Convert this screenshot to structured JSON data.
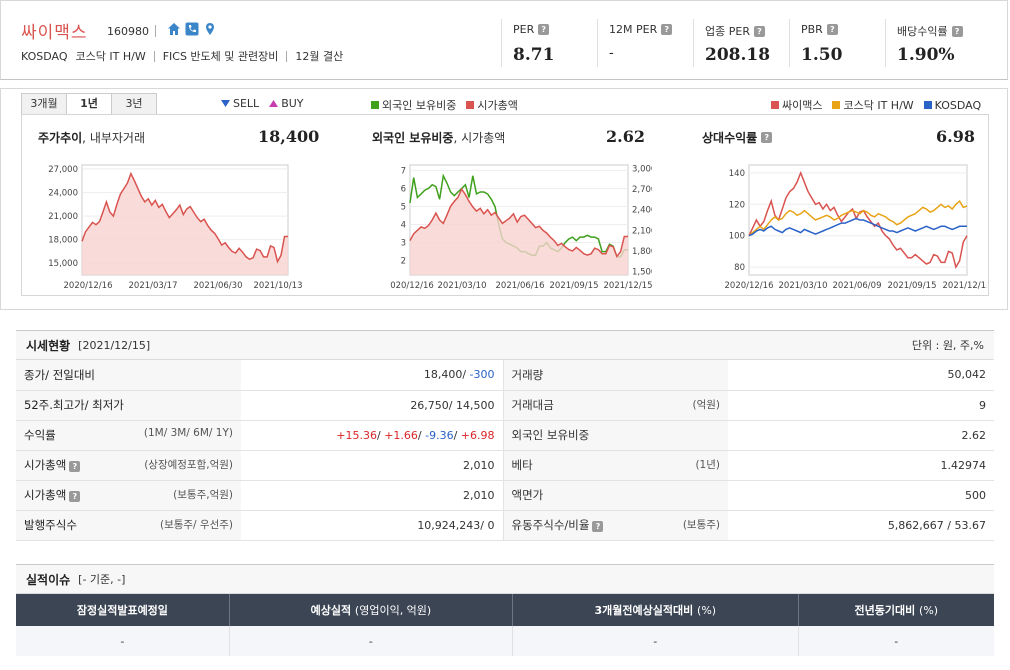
{
  "header": {
    "name": "싸이맥스",
    "code": "160980",
    "market": "KOSDAQ",
    "sector": "코스닥 IT H/W",
    "fics": "FICS 반도체 및 관련장비",
    "settle": "12월 결산",
    "metrics": [
      {
        "label": "PER",
        "value": "8.71"
      },
      {
        "label": "12M PER",
        "value": "-"
      },
      {
        "label": "업종 PER",
        "value": "208.18"
      },
      {
        "label": "PBR",
        "value": "1.50"
      },
      {
        "label": "배당수익률",
        "value": "1.90%"
      }
    ]
  },
  "chart_panel": {
    "tabs": [
      "3개월",
      "1년",
      "3년"
    ],
    "active_tab": "1년",
    "legend_trade": [
      {
        "label": "SELL",
        "color": "#2a62c8"
      },
      {
        "label": "BUY",
        "color": "#c83cb0"
      }
    ],
    "legend_foreign": [
      {
        "label": "외국인 보유비중",
        "color": "#3ea01c"
      },
      {
        "label": "시가총액",
        "color": "#d9534f"
      }
    ],
    "legend_relative": [
      {
        "label": "싸이맥스",
        "color": "#d9534f"
      },
      {
        "label": "코스닥 IT H/W",
        "color": "#e8a317"
      },
      {
        "label": "KOSDAQ",
        "color": "#2a62c8"
      }
    ]
  },
  "chart_data": [
    {
      "type": "area",
      "title": "주가추이",
      "subtitle": "내부자거래",
      "headline": "18,400",
      "x_ticks": [
        "2020/12/16",
        "2021/03/17",
        "2021/06/30",
        "2021/10/13"
      ],
      "y_ticks": [
        "27,000",
        "24,000",
        "21,000",
        "18,000",
        "15,000"
      ],
      "ylim": [
        13500,
        27500
      ],
      "series": [
        {
          "name": "주가",
          "color": "#d9534f",
          "values": [
            17800,
            19000,
            19600,
            20200,
            19900,
            20300,
            21500,
            22800,
            21500,
            21000,
            22500,
            23800,
            24500,
            25200,
            26400,
            25500,
            24500,
            23500,
            22800,
            23200,
            22400,
            23000,
            22100,
            22500,
            21600,
            20800,
            21300,
            21800,
            22400,
            21200,
            21900,
            22200,
            21500,
            20800,
            20300,
            20600,
            19800,
            19200,
            18800,
            18100,
            17300,
            17600,
            17000,
            16500,
            16300,
            16900,
            16400,
            15800,
            15500,
            15700,
            16800,
            16600,
            15800,
            15800,
            17200,
            17000,
            15200,
            16000,
            18400,
            18400
          ]
        }
      ]
    },
    {
      "type": "line",
      "title": "외국인 보유비중",
      "subtitle": "시가총액",
      "headline": "2.62",
      "x_ticks": [
        "020/12/16",
        "2021/03/10",
        "2021/06/16",
        "2021/09/15",
        "2021/12/15"
      ],
      "y_ticks_left": [
        "7",
        "6",
        "5",
        "4",
        "3",
        "2"
      ],
      "y_ticks_right": [
        "3,000",
        "2,700",
        "2,400",
        "2,100",
        "1,800",
        "1,500"
      ],
      "ylim_left": [
        1.2,
        7.3
      ],
      "ylim_right": [
        1450,
        3050
      ],
      "series": [
        {
          "name": "외국인 보유비중",
          "color": "#3ea01c",
          "axis": "left",
          "values": [
            5.2,
            6.6,
            5.5,
            5.7,
            5.9,
            6.0,
            6.2,
            6.1,
            5.4,
            6.7,
            6.3,
            5.8,
            5.6,
            5.8,
            6.0,
            6.2,
            5.5,
            6.7,
            5.7,
            5.8,
            5.8,
            5.7,
            5.4,
            5.0,
            4.0,
            3.2,
            3.0,
            2.9,
            2.8,
            2.7,
            2.5,
            2.5,
            2.4,
            2.3,
            2.3,
            2.8,
            2.8,
            3.0,
            2.7,
            2.6,
            2.5,
            2.7,
            3.0,
            3.2,
            3.3,
            3.1,
            3.3,
            3.3,
            3.4,
            3.3,
            3.3,
            3.2,
            2.5,
            2.5,
            2.9,
            2.8,
            2.2,
            2.2,
            2.6,
            2.6
          ]
        },
        {
          "name": "시가총액",
          "color": "#d9534f",
          "axis": "right",
          "values": [
            1950,
            2050,
            2100,
            2150,
            2130,
            2170,
            2250,
            2350,
            2250,
            2200,
            2320,
            2450,
            2520,
            2580,
            2700,
            2620,
            2520,
            2440,
            2380,
            2420,
            2340,
            2400,
            2320,
            2360,
            2280,
            2200,
            2240,
            2280,
            2340,
            2220,
            2300,
            2320,
            2260,
            2200,
            2140,
            2160,
            2100,
            2060,
            2000,
            1950,
            1880,
            1910,
            1860,
            1820,
            1800,
            1850,
            1810,
            1760,
            1740,
            1760,
            1840,
            1820,
            1760,
            1760,
            1880,
            1860,
            1720,
            1790,
            2010,
            2010
          ]
        }
      ]
    },
    {
      "type": "line",
      "title": "상대수익률",
      "headline": "6.98",
      "x_ticks": [
        "2020/12/16",
        "2021/03/10",
        "2021/06/09",
        "2021/09/15",
        "2021/12/15"
      ],
      "y_ticks": [
        "140",
        "120",
        "100",
        "80"
      ],
      "ylim": [
        75,
        145
      ],
      "series": [
        {
          "name": "싸이맥스",
          "color": "#d9534f",
          "values": [
            100,
            105,
            110,
            106,
            109,
            116,
            122,
            113,
            110,
            117,
            124,
            128,
            130,
            134,
            140,
            134,
            128,
            124,
            120,
            121,
            117,
            120,
            116,
            118,
            113,
            109,
            112,
            115,
            117,
            111,
            115,
            116,
            112,
            109,
            106,
            108,
            103,
            100,
            98,
            94,
            91,
            92,
            89,
            86,
            86,
            88,
            86,
            84,
            82,
            83,
            88,
            87,
            83,
            83,
            90,
            89,
            80,
            84,
            96,
            100
          ]
        },
        {
          "name": "코스닥 IT H/W",
          "color": "#e8a317",
          "values": [
            100,
            102,
            104,
            106,
            104,
            107,
            110,
            112,
            110,
            111,
            114,
            116,
            115,
            113,
            114,
            116,
            114,
            112,
            110,
            111,
            112,
            113,
            112,
            110,
            111,
            113,
            114,
            115,
            116,
            115,
            114,
            116,
            115,
            113,
            112,
            114,
            113,
            112,
            110,
            109,
            107,
            108,
            110,
            112,
            113,
            114,
            116,
            118,
            117,
            115,
            116,
            118,
            120,
            118,
            119,
            117,
            120,
            122,
            118,
            119
          ]
        },
        {
          "name": "KOSDAQ",
          "color": "#2a62c8",
          "values": [
            100,
            101,
            103,
            104,
            103,
            105,
            106,
            104,
            103,
            102,
            104,
            105,
            104,
            103,
            102,
            104,
            103,
            102,
            101,
            102,
            103,
            104,
            105,
            106,
            107,
            108,
            108,
            109,
            110,
            111,
            110,
            110,
            109,
            108,
            107,
            106,
            105,
            104,
            103,
            103,
            102,
            103,
            104,
            105,
            104,
            103,
            104,
            105,
            106,
            105,
            104,
            105,
            106,
            106,
            105,
            104,
            105,
            106,
            106,
            106
          ]
        }
      ]
    }
  ],
  "market_status": {
    "title": "시세현황",
    "date": "[2021/12/15]",
    "unit": "단위 : 원, 주,%",
    "rows": [
      {
        "l1": "종가/ 전일대비",
        "s1": "",
        "v1a": "18,400/",
        "v1b": "-300",
        "v1b_cls": "blue",
        "l2": "거래량",
        "s2": "",
        "v2": "50,042"
      },
      {
        "l1": "52주.최고가/ 최저가",
        "s1": "",
        "v1a": "26,750/ 14,500",
        "v1b": "",
        "v1b_cls": "",
        "l2": "거래대금",
        "s2": "(억원)",
        "v2": "9"
      },
      {
        "l1": "수익률",
        "s1": "(1M/ 3M/ 6M/ 1Y)",
        "v1a": "",
        "v1b": "",
        "v1b_cls": "",
        "l2": "외국인 보유비중",
        "s2": "",
        "v2": "2.62"
      },
      {
        "l1": "시가총액",
        "s1": "(상장예정포함,억원)",
        "v1a": "2,010",
        "v1b": "",
        "v1b_cls": "",
        "l2": "베타",
        "s2": "(1년)",
        "v2": "1.42974"
      },
      {
        "l1": "시가총액",
        "s1": "(보통주,억원)",
        "v1a": "2,010",
        "v1b": "",
        "v1b_cls": "",
        "l2": "액면가",
        "s2": "",
        "v2": "500"
      },
      {
        "l1": "발행주식수",
        "s1": "(보통주/ 우선주)",
        "v1a": "10,924,243/ 0",
        "v1b": "",
        "v1b_cls": "",
        "l2": "유동주식수/비율",
        "s2": "(보통주)",
        "v2": "5,862,667 / 53.67"
      }
    ],
    "returns": [
      "+15.36",
      "+1.66",
      "-9.36",
      "+6.98"
    ]
  },
  "earnings": {
    "title": "실적이슈",
    "sub": "[- 기준, -]",
    "headers": [
      {
        "main": "잠정실적발표예정일",
        "sub": ""
      },
      {
        "main": "예상실적",
        "sub": "(영업이익, 억원)"
      },
      {
        "main": "3개월전예상실적대비",
        "sub": "(%)"
      },
      {
        "main": "전년동기대비",
        "sub": "(%)"
      }
    ],
    "cells": [
      "-",
      "-",
      "-",
      "-"
    ]
  }
}
